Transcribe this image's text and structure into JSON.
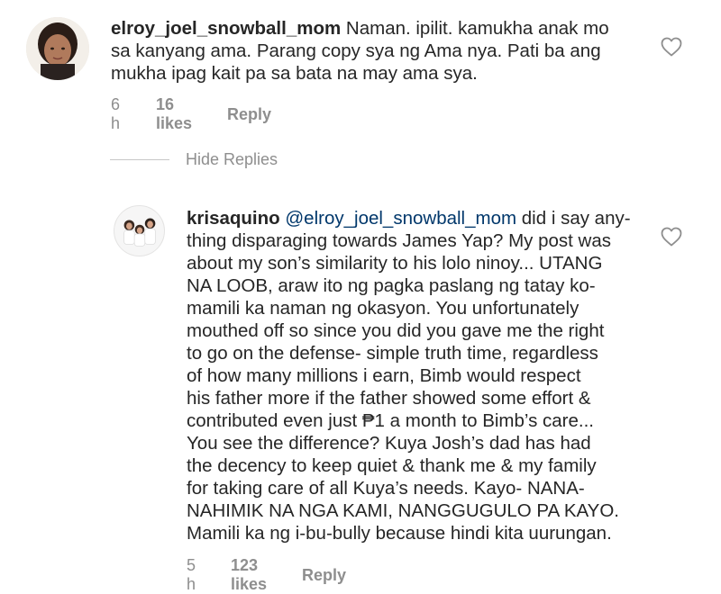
{
  "comment": {
    "username": "elroy_joel_snowball_mom",
    "line1": "Naman. ipilit. kamukha anak mo",
    "line2": "sa kanyang ama. Parang copy sya ng Ama nya. Pati ba ang",
    "line3": "mukha ipag kait pa sa bata na may ama sya.",
    "time": "6 h",
    "likes": "16 likes",
    "reply": "Reply"
  },
  "hide_replies_label": "Hide Replies",
  "reply": {
    "username": "krisaquino",
    "mention": "@elroy_joel_snowball_mom",
    "line1_rest": "did i say any-",
    "lines": [
      "thing disparaging towards James Yap? My post was",
      "about my son’s similarity to his lolo ninoy... UTANG",
      "NA LOOB, araw ito ng pagka paslang ng tatay ko-",
      "mamili ka naman ng okasyon. You unfortunately",
      "mouthed off so since you did you gave me the right",
      "to go on the defense- simple truth time, regardless",
      "of how many millions i earn, Bimb would respect",
      "his father more if the father showed some effort &",
      "contributed even just ₱1 a month to Bimb’s care...",
      "You see the difference? Kuya Josh’s dad has had",
      "the decency to keep quiet & thank me & my family",
      "for taking care of all Kuya’s needs. Kayo- NANA-",
      "NAHIMIK NA NGA KAMI, NANGGUGULO PA KAYO.",
      "Mamili ka ng i-bu-bully because hindi kita uurungan."
    ],
    "time": "5 h",
    "likes": "123 likes",
    "reply": "Reply"
  },
  "icons": {
    "heart": "heart-outline-icon"
  },
  "colors": {
    "text": "#262626",
    "muted": "#8e8e8e",
    "mention": "#00376b"
  }
}
